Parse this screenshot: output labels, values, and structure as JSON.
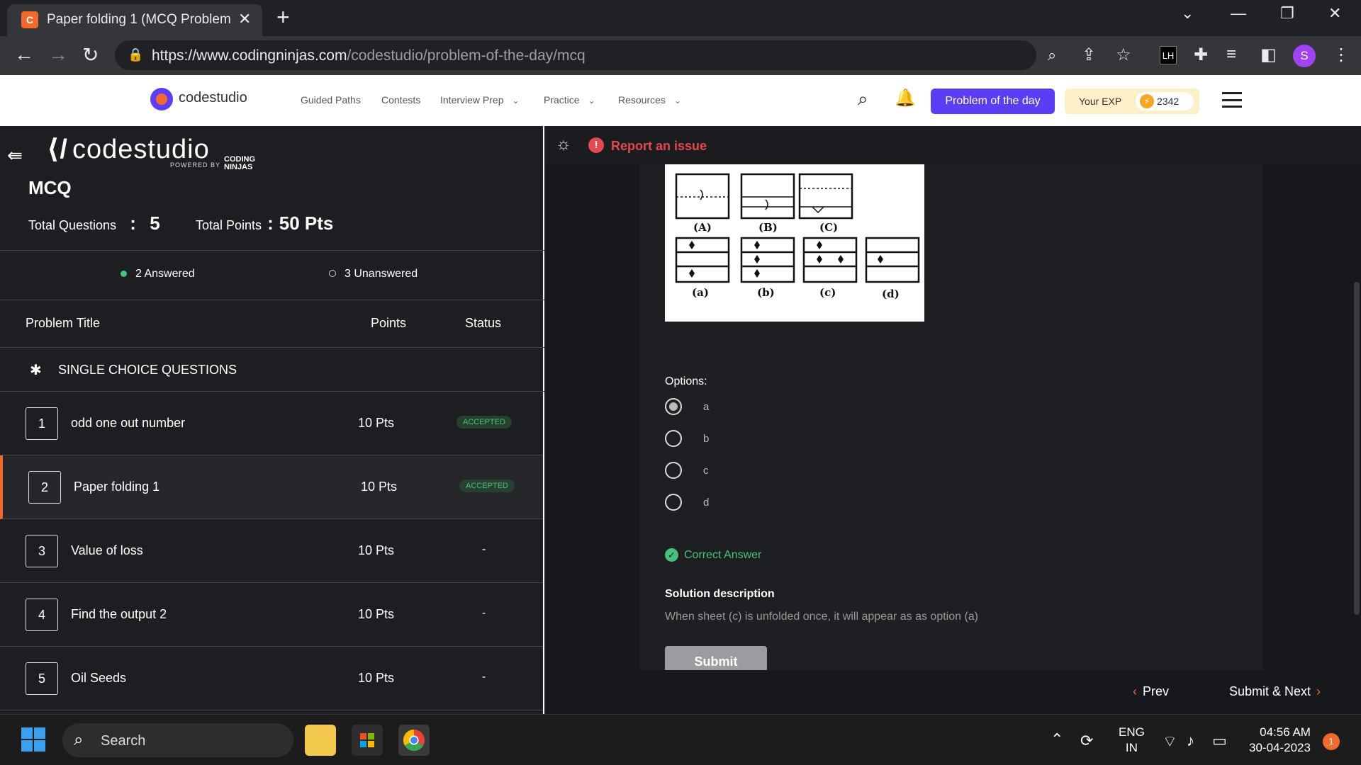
{
  "browser": {
    "tab_title": "Paper folding 1 (MCQ Problem) -",
    "url_domain": "https://www.codingninjas.com",
    "url_path": "/codestudio/problem-of-the-day/mcq"
  },
  "site_header": {
    "logo_text": "codestudio",
    "nav": [
      "Guided Paths",
      "Contests",
      "Interview Prep",
      "Practice",
      "Resources"
    ],
    "potd_label": "Problem of the day",
    "exp_label": "Your EXP",
    "exp_value": "2342"
  },
  "left": {
    "brand": "codestudio",
    "powered_by": "POWERED BY",
    "cn_logo": "CODING NINJAS",
    "title": "MCQ",
    "total_questions_label": "Total Questions",
    "total_questions_value": "5",
    "total_points_label": "Total Points",
    "total_points_value": "50 Pts",
    "answered": "2 Answered",
    "unanswered": "3 Unanswered",
    "columns": {
      "title": "Problem Title",
      "points": "Points",
      "status": "Status"
    },
    "section": "SINGLE CHOICE QUESTIONS",
    "questions": [
      {
        "num": "1",
        "title": "odd one out number",
        "points": "10 Pts",
        "status": "ACCEPTED"
      },
      {
        "num": "2",
        "title": "Paper folding 1",
        "points": "10 Pts",
        "status": "ACCEPTED"
      },
      {
        "num": "3",
        "title": "Value of loss",
        "points": "10 Pts",
        "status": "-"
      },
      {
        "num": "4",
        "title": "Find the output 2",
        "points": "10 Pts",
        "status": "-"
      },
      {
        "num": "5",
        "title": "Oil Seeds",
        "points": "10 Pts",
        "status": "-"
      }
    ]
  },
  "right": {
    "report": "Report an issue",
    "figure_labels": {
      "top": [
        "(A)",
        "(B)",
        "(C)"
      ],
      "bottom": [
        "(a)",
        "(b)",
        "(c)",
        "(d)"
      ]
    },
    "options_label": "Options:",
    "options": [
      "a",
      "b",
      "c",
      "d"
    ],
    "selected_option": "a",
    "correct_answer": "Correct Answer",
    "solution_label": "Solution description",
    "solution_text": "When sheet (c) is unfolded once, it will appear as as option (a)",
    "submit": "Submit",
    "prev": "Prev",
    "submit_next": "Submit & Next"
  },
  "taskbar": {
    "search": "Search",
    "lang": "ENG",
    "region": "IN",
    "time": "04:56 AM",
    "date": "30-04-2023",
    "notifications": "1"
  },
  "colors": {
    "accent": "#5b3df5",
    "orange": "#f26a2b",
    "success": "#46c37b",
    "error": "#e5484d"
  }
}
